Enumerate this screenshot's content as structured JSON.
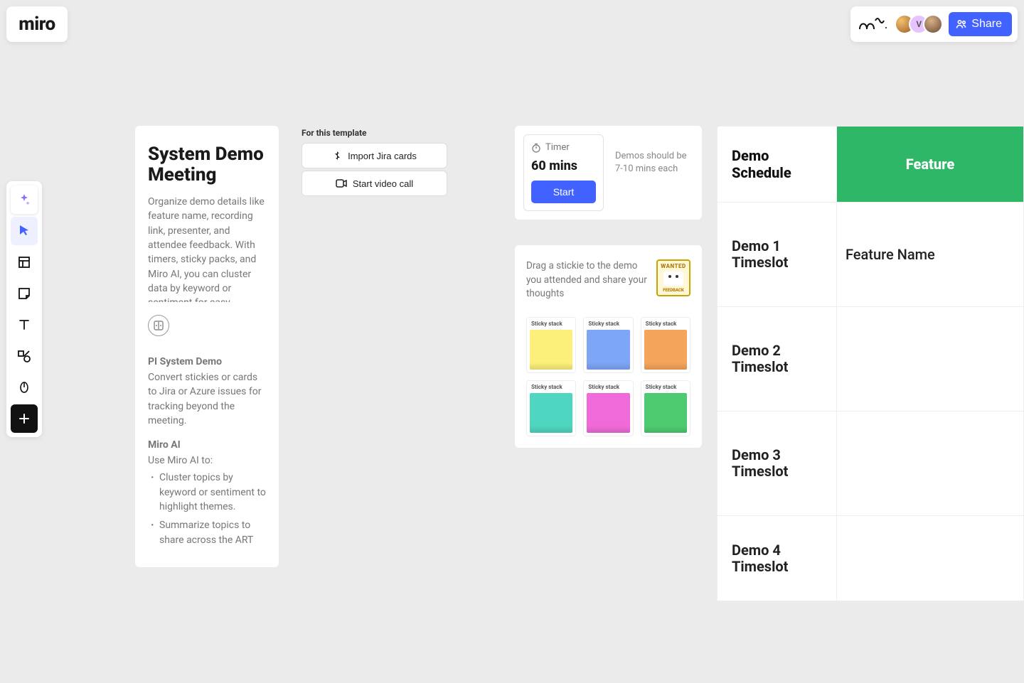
{
  "logo": "miro",
  "topbar": {
    "avatar_initial": "V",
    "share_label": "Share"
  },
  "toolbar": {
    "tools": [
      "ai-sparkle",
      "select",
      "frame",
      "sticky",
      "text",
      "shapes",
      "pen",
      "add"
    ]
  },
  "title_card": {
    "heading": "System Demo Meeting",
    "body": "Organize demo details like feature name, recording link, presenter, and attendee feedback. With timers, sticky packs, and Miro AI, you can cluster data by keyword or sentiment for easy navigation."
  },
  "info_card": {
    "section1_title": "PI System Demo",
    "section1_body": "Convert stickies or cards to Jira or Azure issues for tracking beyond the meeting.",
    "section2_title": "Miro AI",
    "section2_lead": "Use Miro AI to:",
    "bullets": [
      "Cluster topics by keyword or sentiment to highlight themes.",
      "Summarize topics to share across the ART"
    ]
  },
  "template_actions": {
    "label": "For this template",
    "import_label": "Import Jira cards",
    "video_label": "Start video call"
  },
  "timer_card": {
    "title": "Timer",
    "value": "60 mins",
    "start_label": "Start",
    "note": "Demos should be 7-10 mins each"
  },
  "stickies_card": {
    "instruction": "Drag a stickie to the demo you attended and share your thoughts",
    "wanted_title": "WANTED",
    "wanted_sub": "FEEDBACK",
    "stack_label": "Sticky stack",
    "colors": [
      "#fdf07a",
      "#7ea6f6",
      "#f4a45b",
      "#4fd6c0",
      "#f06bd9",
      "#4ecb71"
    ]
  },
  "schedule": {
    "header_label": "Demo Schedule",
    "header_feature": "Feature",
    "rows": [
      {
        "label": "Demo 1 Timeslot",
        "cell": "Feature Name"
      },
      {
        "label": "Demo 2 Timeslot",
        "cell": ""
      },
      {
        "label": "Demo 3 Timeslot",
        "cell": ""
      },
      {
        "label": "Demo 4 Timeslot",
        "cell": ""
      }
    ]
  }
}
